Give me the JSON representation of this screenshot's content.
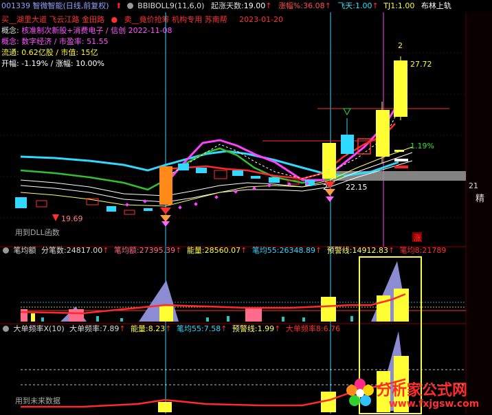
{
  "header": {
    "stock": "001339 智微智能(日线,前复权)",
    "indicator": "BBIBOLL9(11,6,0)",
    "stat1_label": "起涨天数:",
    "stat1_value": "19.00",
    "stat2_label": "涨幅%:",
    "stat2_value": "36.08",
    "stat3_label": "飞天:",
    "stat3_value": "1.00",
    "stat4_label": "TJ1:",
    "stat4_value": "1.00",
    "stat5_label": "布林上轨"
  },
  "info": {
    "line1": "买__湖里大道 飞云江路 金田路",
    "line1b": "卖__竟价抢筹 机构专用 苏南帮",
    "line1_date": "2023-01-20",
    "line2_label": "概念:",
    "line2_text": "核准制次新股+消费电子 / 信创 2022-11-08",
    "line3_label": "概念:",
    "line3_text": "数字经济 / 市盈率:",
    "line3_value": "51.55",
    "line4_label": "流通:",
    "line4_a": "0.62亿股",
    "line4_b": "/ 市值:",
    "line4_c": "15亿",
    "line5_label": "开幅:",
    "line5_a": "-1.19%",
    "line5_b": "/ 涨幅:",
    "line5_c": "10.00%"
  },
  "price_labels": {
    "top_count": "2",
    "high": "27.72",
    "pct": "1.19%",
    "low_left": "19.69",
    "low_mid": "22.15",
    "low_mid_prefix": "2",
    "right_edge": "21",
    "right_edge2": "精",
    "limit_badge": "涨",
    "dll_note": "用到DLL函数"
  },
  "panel2": {
    "name": "笔均额",
    "a_label": "分笔数:",
    "a_value": "24817.00",
    "b_label": "笔均额:",
    "b_value": "27395.39",
    "c_label": "能量:",
    "c_value": "28560.07",
    "d_label": "笔均55:",
    "d_value": "26348.89",
    "e_label": "预警线:",
    "e_value": "14912.83",
    "f_label": "笔均8:",
    "f_value": "21789"
  },
  "panel3": {
    "name": "大单频率X(10)",
    "a_label": "大单频率:",
    "a_value": "7.89",
    "c_label": "能量:",
    "c_value": "8.23",
    "d_label": "笔均55:",
    "d_value": "7.58",
    "e_label": "预警线:",
    "e_value": "1.99",
    "f_label": "大单频率8:",
    "f_value": "6.76",
    "note": "用到未来数据"
  },
  "watermark": {
    "title": "分析家公式网",
    "url": "www.fxjgsw.com"
  },
  "colors": {
    "cyan": "#2fd9ff",
    "yellow": "#ffff33",
    "red": "#ff2a2a",
    "magenta": "#ff40ff",
    "lavender": "#8c8cd2"
  }
}
